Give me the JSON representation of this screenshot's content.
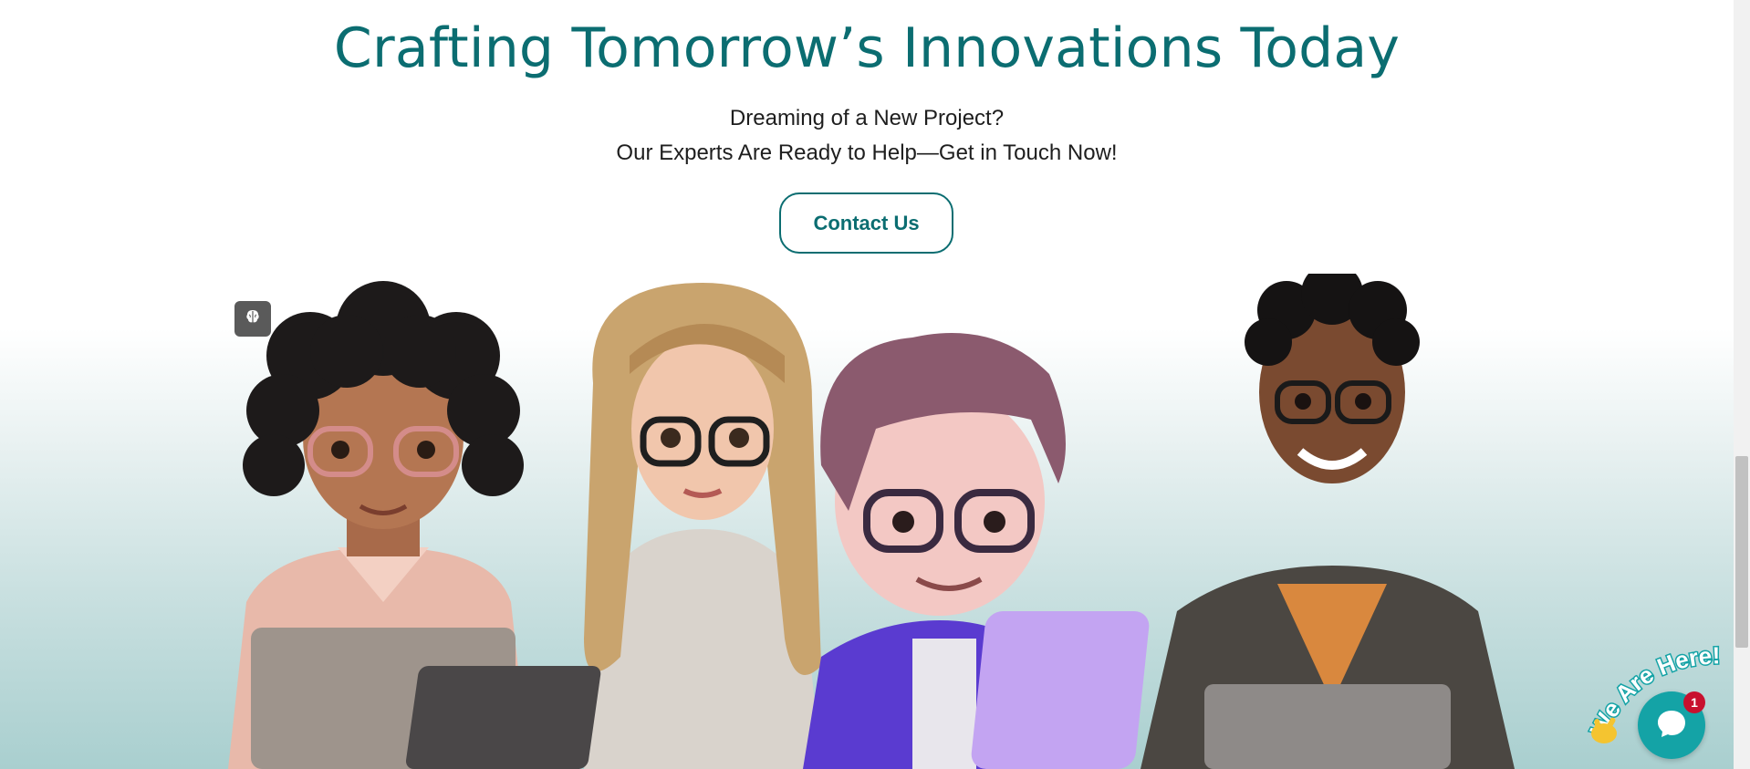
{
  "hero": {
    "headline": "Crafting Tomorrow’s Innovations Today",
    "subline_1": "Dreaming of a New Project?",
    "subline_2": "Our Experts Are Ready to Help—Get in Touch Now!",
    "cta_label": "Contact Us"
  },
  "chat_widget": {
    "badge_text": "We Are Here!",
    "notification_count": "1"
  },
  "icons": {
    "brain": "brain-icon",
    "chat": "chat-bubble-icon",
    "wave": "waving-hand-icon"
  },
  "colors": {
    "brand": "#0b6d71",
    "chat_accent": "#14a3a6",
    "notification": "#c8102e"
  }
}
